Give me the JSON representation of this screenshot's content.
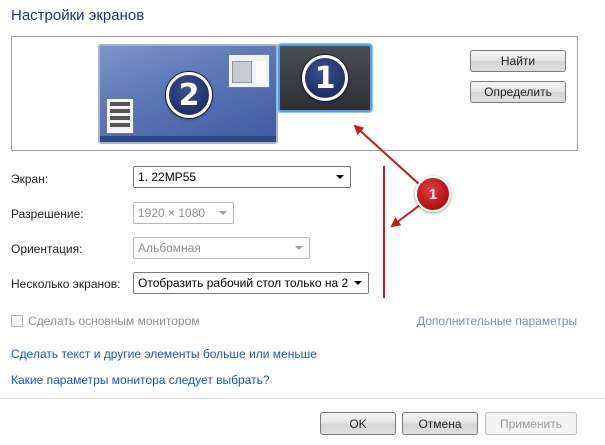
{
  "title": "Настройки экранов",
  "preview": {
    "monitor_2_number": "2",
    "monitor_1_number": "1",
    "find_label": "Найти",
    "identify_label": "Определить"
  },
  "settings": {
    "screen": {
      "label": "Экран:",
      "value": "1. 22MP55"
    },
    "resolution": {
      "label": "Разрешение:",
      "value": "1920 × 1080"
    },
    "orientation": {
      "label": "Ориентация:",
      "value": "Альбомная"
    },
    "multiple": {
      "label": "Несколько экранов:",
      "value": "Отобразить рабочий стол только на 2"
    }
  },
  "primary_checkbox_label": "Сделать основным монитором",
  "advanced_link": "Дополнительные параметры",
  "links": {
    "text_size": "Сделать текст и другие элементы больше или меньше",
    "which_params": "Какие параметры монитора следует выбрать?"
  },
  "footer": {
    "ok": "OK",
    "cancel": "Отмена",
    "apply": "Применить"
  },
  "annotation": {
    "number": "1",
    "color": "#d01818"
  }
}
